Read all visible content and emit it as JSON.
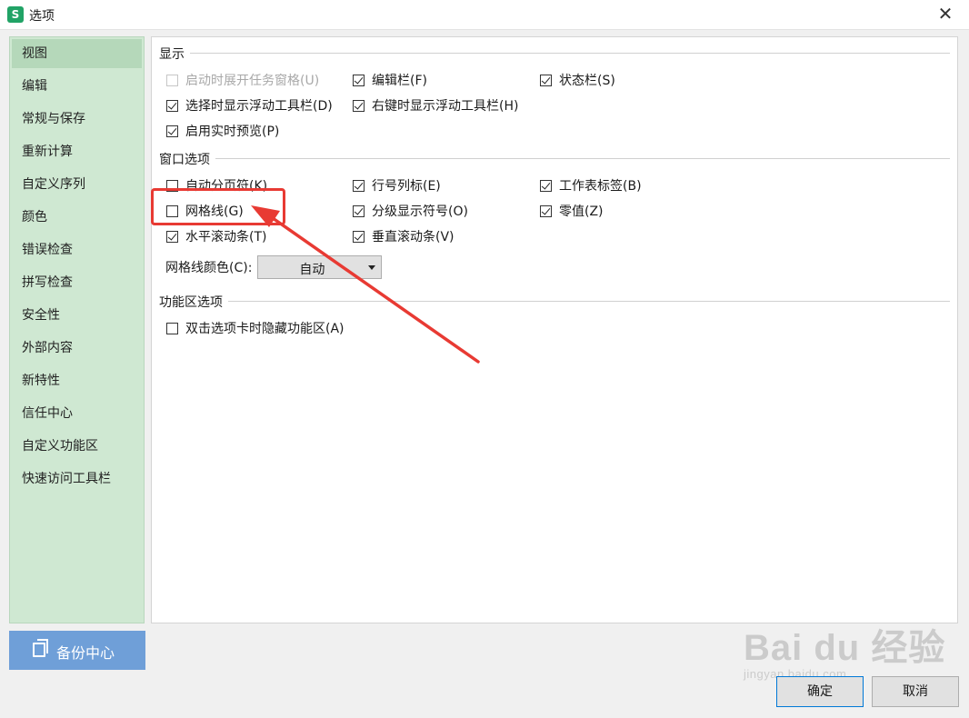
{
  "window": {
    "app_icon": "S",
    "title": "选项",
    "close_glyph": "✕"
  },
  "sidebar": {
    "items": [
      {
        "label": "视图"
      },
      {
        "label": "编辑"
      },
      {
        "label": "常规与保存"
      },
      {
        "label": "重新计算"
      },
      {
        "label": "自定义序列"
      },
      {
        "label": "颜色"
      },
      {
        "label": "错误检查"
      },
      {
        "label": "拼写检查"
      },
      {
        "label": "安全性"
      },
      {
        "label": "外部内容"
      },
      {
        "label": "新特性"
      },
      {
        "label": "信任中心"
      },
      {
        "label": "自定义功能区"
      },
      {
        "label": "快速访问工具栏"
      }
    ],
    "selected": "视图",
    "backup_label": "备份中心"
  },
  "display": {
    "title": "显示",
    "opts": [
      {
        "label": "启动时展开任务窗格(U)",
        "checked": false,
        "disabled": true
      },
      {
        "label": "编辑栏(F)",
        "checked": true
      },
      {
        "label": "状态栏(S)",
        "checked": true
      },
      {
        "label": "选择时显示浮动工具栏(D)",
        "checked": true
      },
      {
        "label": "右键时显示浮动工具栏(H)",
        "checked": true
      },
      {
        "label": "启用实时预览(P)",
        "checked": true
      }
    ]
  },
  "window_options": {
    "title": "窗口选项",
    "opts": [
      {
        "label": "自动分页符(K)",
        "checked": false
      },
      {
        "label": "行号列标(E)",
        "checked": true
      },
      {
        "label": "工作表标签(B)",
        "checked": true
      },
      {
        "label": "网格线(G)",
        "checked": false
      },
      {
        "label": "分级显示符号(O)",
        "checked": true
      },
      {
        "label": "零值(Z)",
        "checked": true
      },
      {
        "label": "水平滚动条(T)",
        "checked": true
      },
      {
        "label": "垂直滚动条(V)",
        "checked": true
      }
    ],
    "gridline_color_label": "网格线颜色(C):",
    "gridline_color_value": "自动"
  },
  "ribbon": {
    "title": "功能区选项",
    "opts": [
      {
        "label": "双击选项卡时隐藏功能区(A)",
        "checked": false
      }
    ]
  },
  "buttons": {
    "ok": "确定",
    "cancel": "取消"
  },
  "watermark": {
    "main": "Bai du 经验",
    "sub": "jingyan.baidu.com"
  },
  "colors": {
    "sidebar_bg": "#cfe8d2",
    "backup_bg": "#6f9fd8",
    "annotation": "#e83a33"
  }
}
